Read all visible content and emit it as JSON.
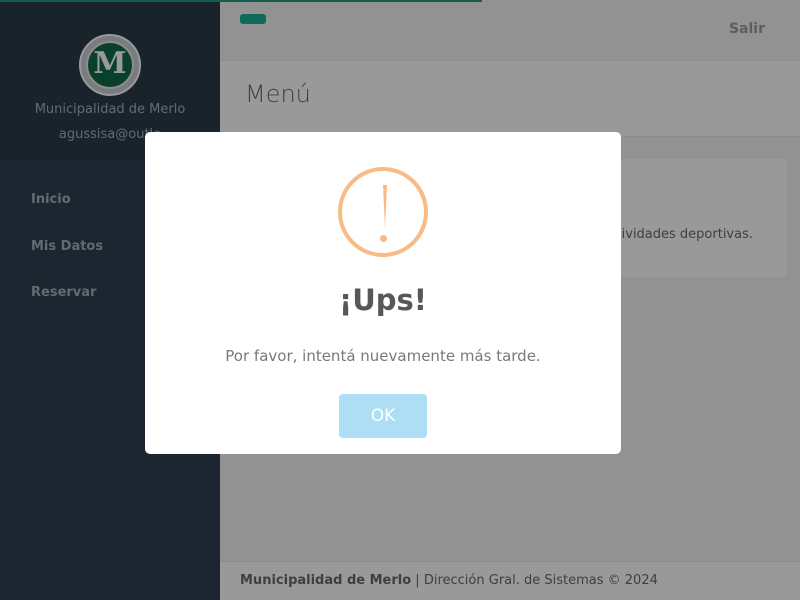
{
  "sidebar": {
    "logo_letter": "M",
    "org_name": "Municipalidad de Merlo",
    "user_email": "agussisa@outlo",
    "items": [
      {
        "label": "Inicio"
      },
      {
        "label": "Mis Datos"
      },
      {
        "label": "Reservar"
      }
    ]
  },
  "topbar": {
    "logout_label": "Salir"
  },
  "page": {
    "title": "Menú"
  },
  "content": {
    "card_text": "ctividades deportivas."
  },
  "footer": {
    "org": "Municipalidad de Merlo",
    "separator": " | ",
    "rest": "Dirección Gral. de Sistemas © 2024"
  },
  "modal": {
    "icon": "exclamation-icon",
    "title": "¡Ups!",
    "message": "Por favor, intentá nuevamente más tarde.",
    "button_label": "OK"
  },
  "colors": {
    "accent": "#1ab394",
    "sidebar": "#2f4050",
    "warning": "#f8bb86",
    "ok_button": "#aedef4"
  }
}
